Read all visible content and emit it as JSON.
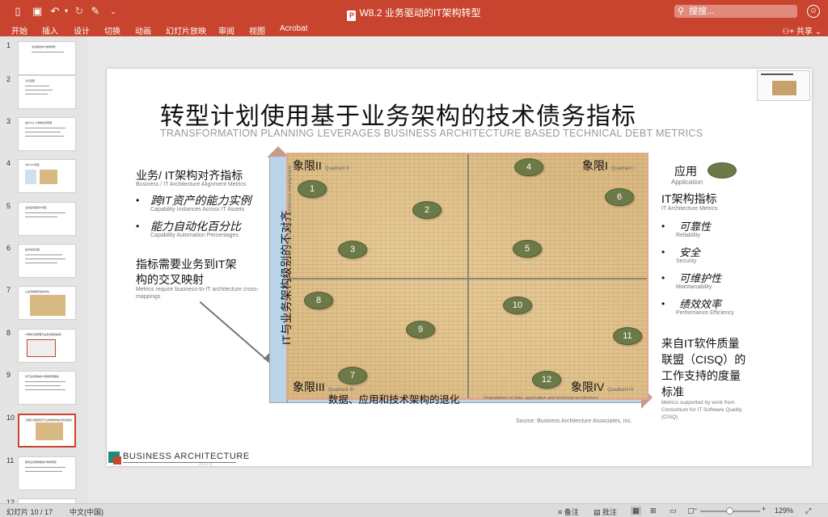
{
  "window": {
    "title": "W8.2 业务驱动的IT架构转型",
    "search_placeholder": "搜搜...",
    "quick_icons": [
      "sidebar-toggle-icon",
      "save-icon",
      "undo-icon",
      "redo-icon",
      "format-painter-icon",
      "more-icon"
    ]
  },
  "ribbon": {
    "tabs": [
      "开始",
      "插入",
      "设计",
      "切换",
      "动画",
      "幻灯片放映",
      "审阅",
      "视图",
      "Acrobat"
    ],
    "share_label": "共享"
  },
  "thumbnails": [
    {
      "num": "1",
      "title": "业务驱动的IT架构转型"
    },
    {
      "num": "2",
      "title": "今天话题"
    },
    {
      "num": "3",
      "title": "是什么让 IT架构必须转型"
    },
    {
      "num": "4",
      "title": "为什么IT转型"
    },
    {
      "num": "5",
      "title": "业务如何驱动IT转型"
    },
    {
      "num": "6",
      "title": "技术债务问题"
    },
    {
      "num": "7",
      "title": "从业务角度评估技术债"
    },
    {
      "num": "8",
      "title": "IT架构元素质量与业务关联的案例"
    },
    {
      "num": "9",
      "title": "基于业务架构的IT架构转型路线"
    },
    {
      "num": "10",
      "title": "转型计划使用基于业务架构的技术债务指标",
      "selected": true
    },
    {
      "num": "11",
      "title": "使用业务架构推动IT架构转型"
    },
    {
      "num": "12",
      "title": ""
    }
  ],
  "slide": {
    "title": "转型计划使用基于业务架构的技术债务指标",
    "subtitle": "TRANSFORMATION PLANNING LEVERAGES BUSINESS ARCHITECTURE BASED TECHNICAL DEBT METRICS",
    "left": {
      "heading": "业务/ IT架构对齐指标",
      "heading_en": "Business / IT Architecture Alignment Metrics",
      "items": [
        {
          "label": "跨IT资产的能力实例",
          "en": "Capability Instances Across IT Assets"
        },
        {
          "label": "能力自动化百分比",
          "en": "Capability Automation Percentages"
        }
      ],
      "note_line1": "指标需要业务到IT架",
      "note_line2": "构的交叉映射",
      "note_en_line1": "Metrics require business-to-IT architecture cross-",
      "note_en_line2": "mappings"
    },
    "right": {
      "app_label": "应用",
      "app_en": "Application",
      "metrics_heading": "IT架构指标",
      "metrics_en": "IT Architecture Metrics",
      "metrics": [
        {
          "label": "可靠性",
          "en": "Reliability"
        },
        {
          "label": "安全",
          "en": "Security"
        },
        {
          "label": "可维护性",
          "en": "Maintainability"
        },
        {
          "label": "绩效效率",
          "en": "Performance Efficiency"
        }
      ],
      "cisq_line1": "来自IT软件质量",
      "cisq_line2": "联盟（CISQ）的",
      "cisq_line3": "工作支持的度量",
      "cisq_line4": "标准",
      "cisq_en_line1": "Metrics    supported    by    work    from",
      "cisq_en_line2": "Consortium  for  IT  Software  Quality",
      "cisq_en_line3": "(CISQ)"
    },
    "matrix": {
      "quadrants": [
        {
          "label": "象限II",
          "en": "Quadrant II"
        },
        {
          "label": "象限I",
          "en": "Quadrant I"
        },
        {
          "label": "象限III",
          "en": "Quadrant III"
        },
        {
          "label": "象限IV",
          "en": "Quadrant IV"
        }
      ],
      "y_axis": "IT与业务架构级别的不对齐",
      "y_axis_en": "Level of IT & business architecture misalignment",
      "x_axis": "数据、应用和技术架构的退化",
      "x_axis_en": "Degradation of data, application and technical architecture",
      "points": [
        "1",
        "2",
        "3",
        "4",
        "5",
        "6",
        "7",
        "8",
        "9",
        "10",
        "11",
        "12"
      ]
    },
    "source": "Source: Business Architecture Associates, Inc.",
    "logo": {
      "text": "BUSINESS ARCHITECTURE",
      "sub": "GUILD"
    }
  },
  "status": {
    "slide_counter": "幻灯片 10 / 17",
    "language": "中文(中国)",
    "notes": "备注",
    "comments": "批注",
    "zoom": "129%"
  },
  "colors": {
    "accent": "#c9442f",
    "bubble": "#6c7a48",
    "axis": "#b9d4e8"
  }
}
